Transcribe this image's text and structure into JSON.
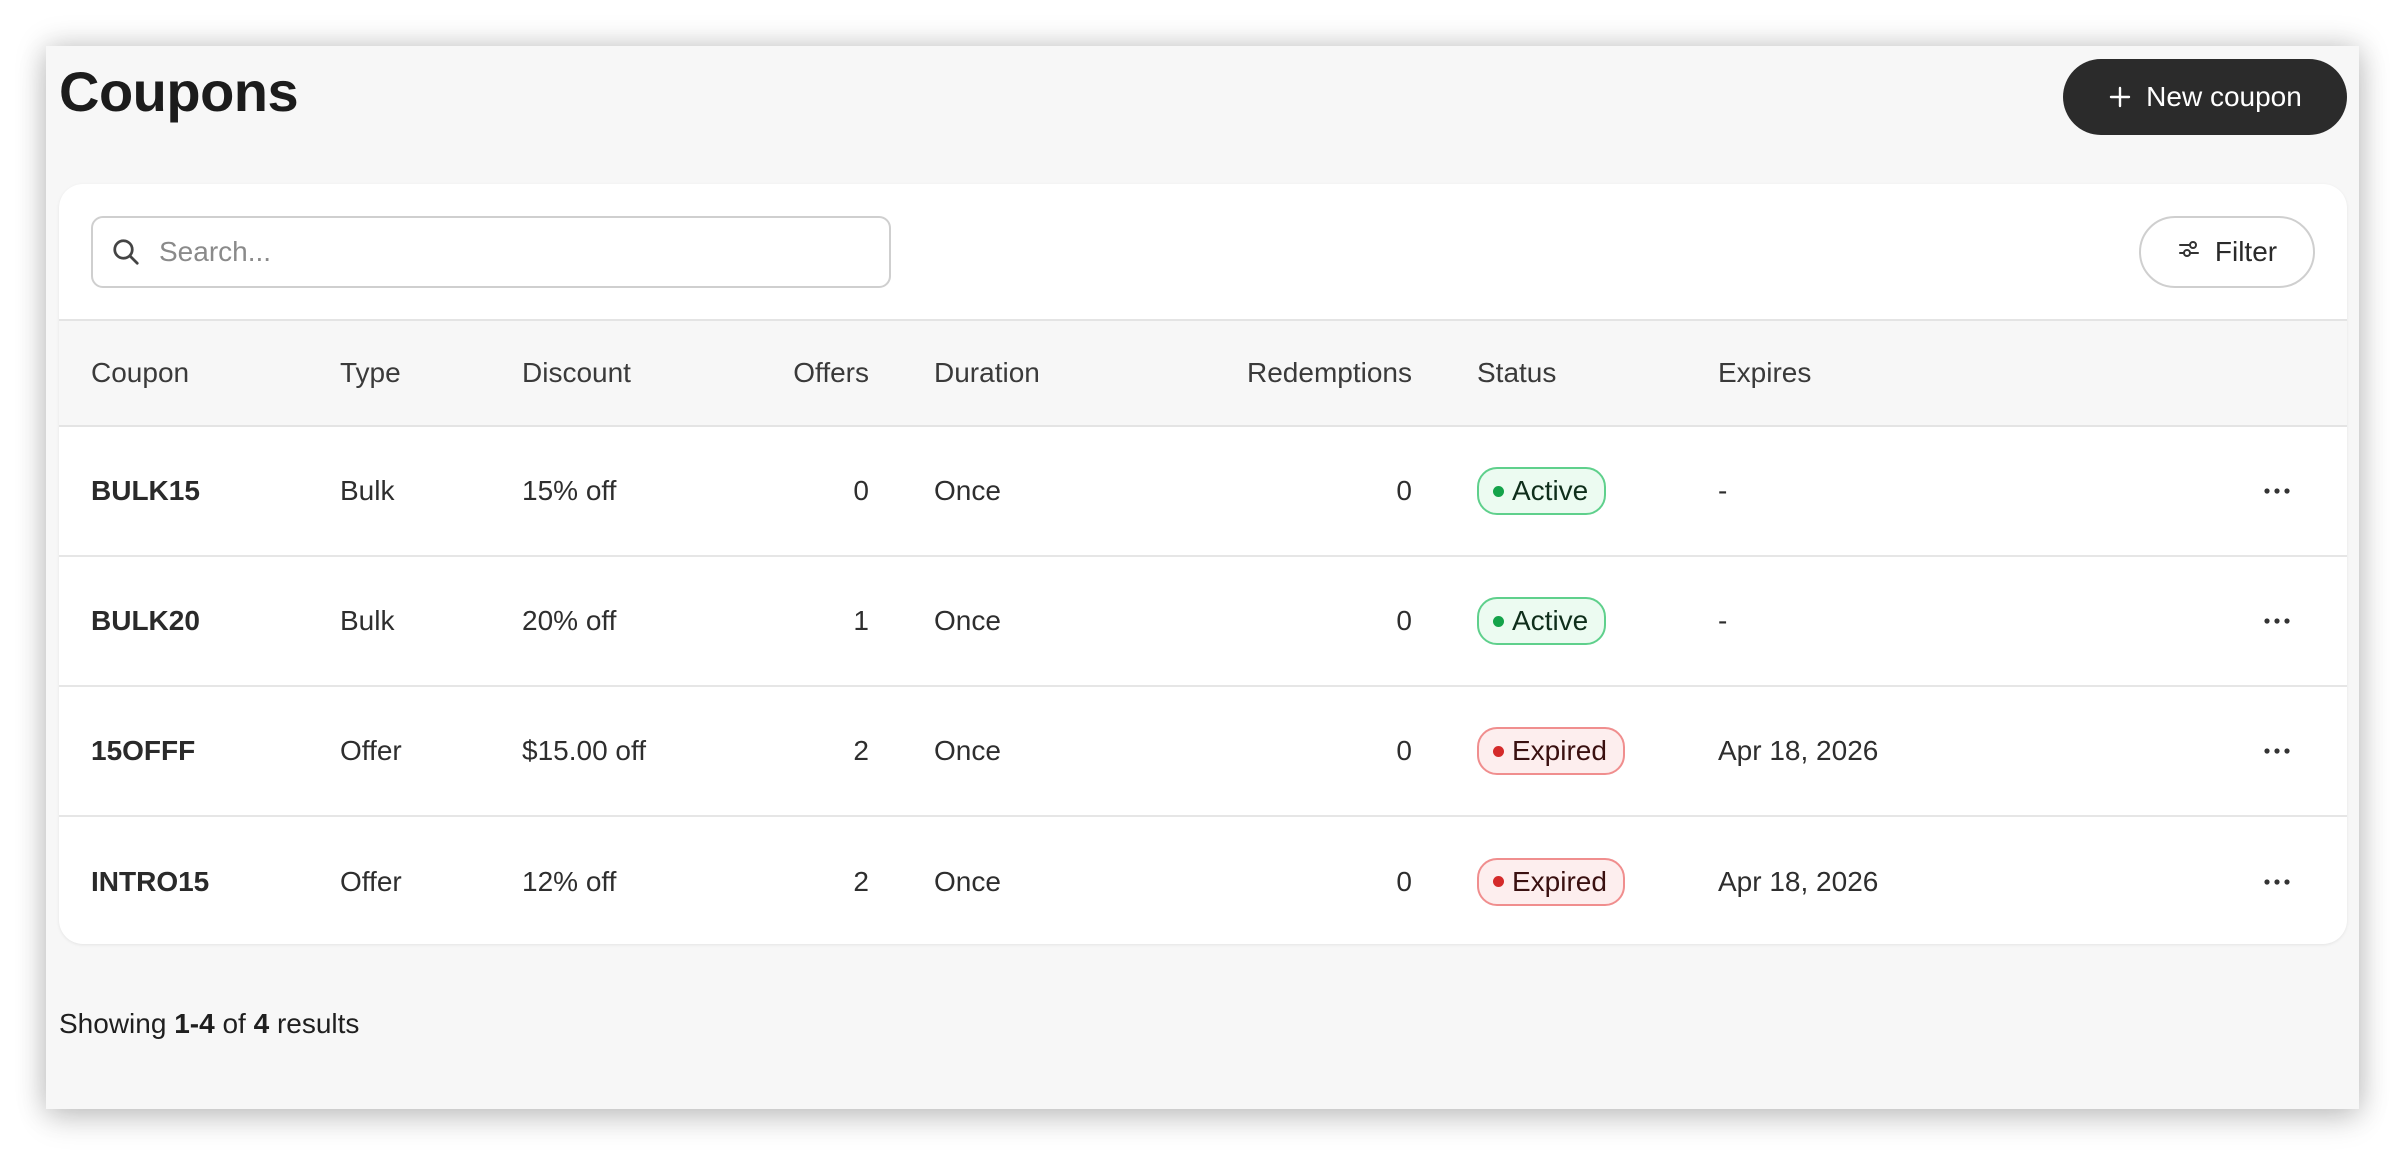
{
  "page": {
    "title": "Coupons",
    "new_button_label": "New coupon"
  },
  "toolbar": {
    "search_placeholder": "Search...",
    "filter_label": "Filter"
  },
  "table": {
    "columns": [
      "Coupon",
      "Type",
      "Discount",
      "Offers",
      "Duration",
      "Redemptions",
      "Status",
      "Expires"
    ],
    "rows": [
      {
        "coupon": "BULK15",
        "type": "Bulk",
        "discount": "15% off",
        "offers": "0",
        "duration": "Once",
        "redemptions": "0",
        "status": "Active",
        "expires": "-"
      },
      {
        "coupon": "BULK20",
        "type": "Bulk",
        "discount": "20% off",
        "offers": "1",
        "duration": "Once",
        "redemptions": "0",
        "status": "Active",
        "expires": "-"
      },
      {
        "coupon": "15OFFF",
        "type": "Offer",
        "discount": "$15.00 off",
        "offers": "2",
        "duration": "Once",
        "redemptions": "0",
        "status": "Expired",
        "expires": "Apr 18, 2026"
      },
      {
        "coupon": "INTRO15",
        "type": "Offer",
        "discount": "12% off",
        "offers": "2",
        "duration": "Once",
        "redemptions": "0",
        "status": "Expired",
        "expires": "Apr 18, 2026"
      }
    ]
  },
  "footer": {
    "showing": "Showing",
    "range": "1-4",
    "of": "of",
    "total": "4",
    "results": "results"
  },
  "icons": {
    "plus": "plus-icon",
    "search": "search-icon",
    "filter": "filter-icon",
    "more": "more-horizontal-icon"
  },
  "colors": {
    "primary_button": "#2b2b2b",
    "active_dot": "#14a34a",
    "active_border": "#5fd08c",
    "expired_dot": "#d42a2a",
    "expired_border": "#f08e8e"
  }
}
